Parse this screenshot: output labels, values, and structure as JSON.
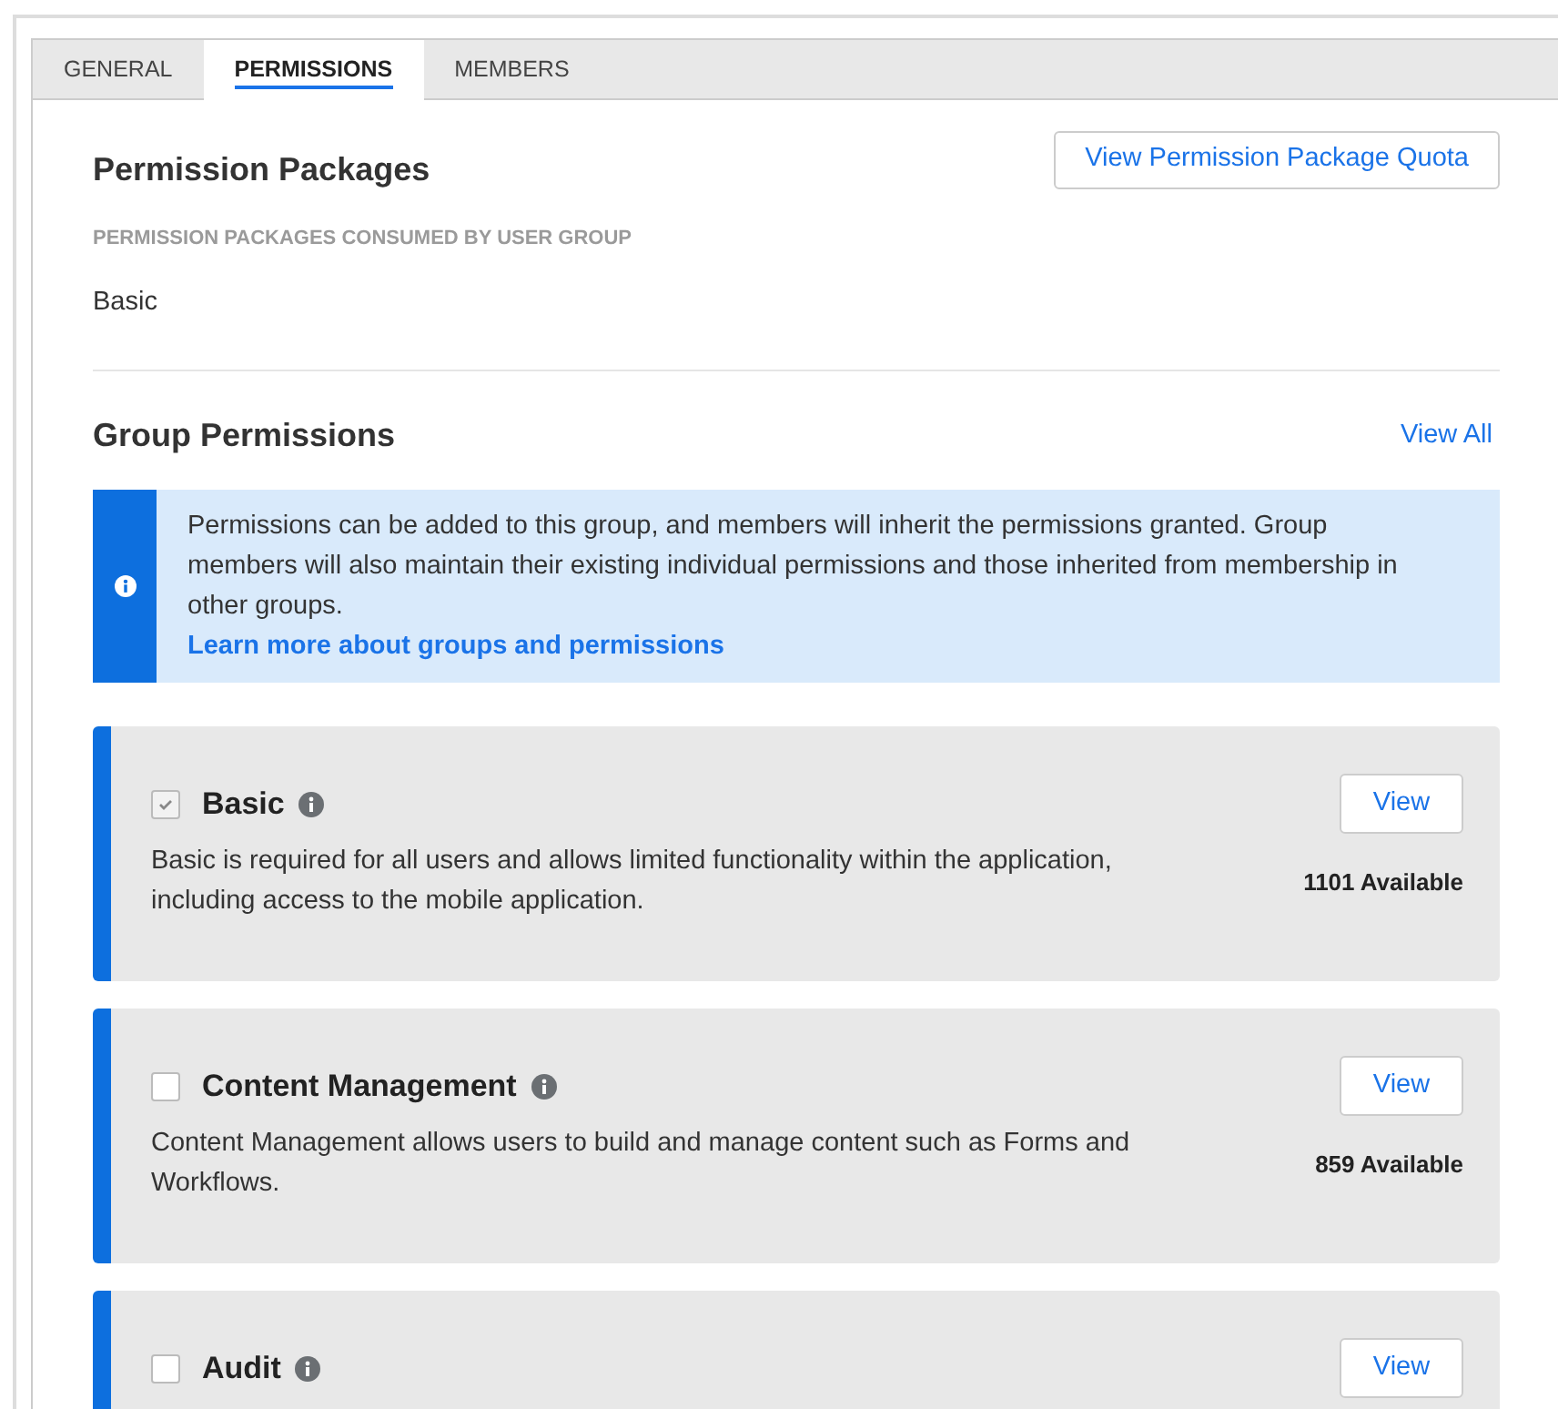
{
  "tabs": [
    {
      "label": "GENERAL",
      "selected": false
    },
    {
      "label": "PERMISSIONS",
      "selected": true
    },
    {
      "label": "MEMBERS",
      "selected": false
    }
  ],
  "packages": {
    "title": "Permission Packages",
    "quota_button": "View Permission Package Quota",
    "consumed_label": "PERMISSION PACKAGES CONSUMED BY USER GROUP",
    "consumed_value": "Basic"
  },
  "group_permissions": {
    "title": "Group Permissions",
    "view_all": "View All",
    "notice": {
      "text": "Permissions can be added to this group, and members will inherit the permissions granted. Group members will also maintain their existing individual permissions and those inherited from membership in other groups.",
      "link": "Learn more about groups and permissions"
    },
    "items": [
      {
        "name": "Basic",
        "checked": true,
        "disabled": true,
        "description": "Basic is required for all users and allows limited functionality within the application, including access to the mobile application.",
        "available": "1101 Available",
        "button": "View"
      },
      {
        "name": "Content Management",
        "checked": false,
        "disabled": false,
        "description": "Content Management allows users to build and manage content such as Forms and Workflows.",
        "available": "859 Available",
        "button": "View"
      },
      {
        "name": "Audit",
        "checked": false,
        "disabled": false,
        "button": "View"
      }
    ]
  }
}
